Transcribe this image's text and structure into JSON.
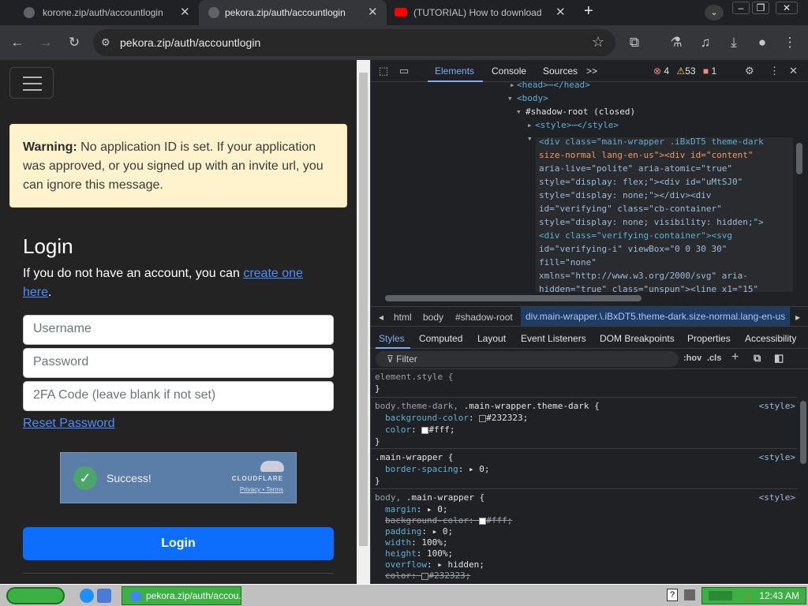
{
  "browser": {
    "tabs": [
      {
        "title": "korone.zip/auth/accountlogin"
      },
      {
        "title": "pekora.zip/auth/accountlogin"
      },
      {
        "title": "(TUTORIAL) How to download Pek"
      }
    ],
    "new_tab": "+",
    "url": "pekora.zip/auth/accountlogin"
  },
  "page": {
    "warning_strong": "Warning:",
    "warning_text": " No application ID is set. If your application was approved, or you signed up with an invite url, you can ignore this message.",
    "login_title": "Login",
    "login_sub_prefix": "If you do not have an account, you can ",
    "login_sub_link": "create one here",
    "login_sub_suffix": ".",
    "username_placeholder": "Username",
    "password_placeholder": "Password",
    "twofa_placeholder": "2FA Code (leave blank if not set)",
    "reset_password": "Reset Password",
    "captcha": {
      "status": "Success!",
      "brand": "CLOUDFLARE",
      "links": "Privacy • Terms"
    },
    "login_button": "Login"
  },
  "devtools": {
    "tabs": [
      "Elements",
      "Console",
      "Sources",
      ">>"
    ],
    "errors": "4",
    "warnings": "53",
    "issues": "1",
    "dom_lines": [
      {
        "t": "<head>⋯</head>"
      },
      {
        "t": "<body>"
      },
      {
        "t": "#shadow-root (closed)"
      },
      {
        "t": "<style>⋯</style>"
      },
      {
        "t": "<div class=\"main-wrapper .iBxDT5 theme-dark"
      },
      {
        "t": "size-normal lang-en-us\"><div id=\"content\""
      },
      {
        "t": "aria-live=\"polite\" aria-atomic=\"true\""
      },
      {
        "t": "style=\"display: flex;\"><div id=\"uMtSJ0\""
      },
      {
        "t": "style=\"display: none;\"></div><div"
      },
      {
        "t": "id=\"verifying\" class=\"cb-container\""
      },
      {
        "t": "style=\"display: none; visibility: hidden;\">"
      },
      {
        "t": "<div class=\"verifying-container\"><svg"
      },
      {
        "t": "id=\"verifying-i\" viewBox=\"0 0 30 30\""
      },
      {
        "t": "fill=\"none\""
      },
      {
        "t": "xmlns=\"http://www.w3.org/2000/svg\" aria-"
      },
      {
        "t": "hidden=\"true\" class=\"unspun\"><line x1=\"15\""
      }
    ],
    "breadcrumbs": [
      "html",
      "body",
      "#shadow-root",
      "div.main-wrapper.\\.iBxDT5.theme-dark.size-normal.lang-en-us"
    ],
    "subtabs": [
      "Styles",
      "Computed",
      "Layout",
      "Event Listeners",
      "DOM Breakpoints",
      "Properties",
      "Accessibility"
    ],
    "filter_placeholder": "Filter",
    "filter_tools": [
      ":hov",
      ".cls"
    ],
    "styles": {
      "element_style": "element.style {",
      "close": "}",
      "rule1_selector_dim": "body.theme-dark,",
      "rule1_selector": " .main-wrapper.theme-dark {",
      "rule1_src": "<style>",
      "rule1_p1": "background-color",
      "rule1_v1": "#232323",
      "rule1_p2": "color",
      "rule1_v2": "#fff",
      "rule2_selector": ".main-wrapper {",
      "rule2_p1": "border-spacing",
      "rule2_v1": "0",
      "rule3_selector_dim": "body,",
      "rule3_selector": " .main-wrapper {",
      "rule3_props": [
        {
          "p": "margin",
          "v": "▸ 0"
        },
        {
          "p": "background-color",
          "v": "#fff",
          "strike": true
        },
        {
          "p": "padding",
          "v": "▸ 0"
        },
        {
          "p": "width",
          "v": "100%"
        },
        {
          "p": "height",
          "v": "100%"
        },
        {
          "p": "overflow",
          "v": "▸ hidden"
        },
        {
          "p": "color",
          "v": "#232323",
          "strike": true
        }
      ]
    }
  },
  "taskbar": {
    "task_label": "pekora.zip/auth/accou...",
    "clock": "12:43 AM",
    "help": "?"
  },
  "colors": {
    "page_bg": "#232323",
    "warning_bg": "#fff3cd",
    "link": "#4d8cff",
    "primary_button": "#0d6efd",
    "devtools_accent": "#7cacf8"
  }
}
